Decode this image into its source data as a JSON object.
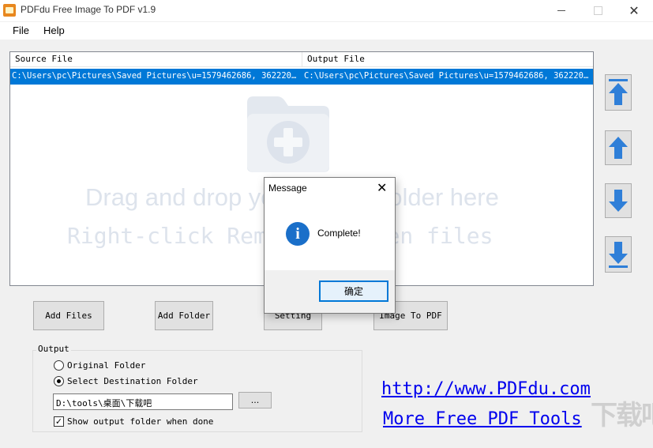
{
  "window": {
    "title": "PDFdu Free Image To PDF  v1.9",
    "app_icon": "pdfdu-logo-icon"
  },
  "menu": {
    "items": [
      "File",
      "Help"
    ]
  },
  "filelist": {
    "columns": [
      "Source File",
      "Output File"
    ],
    "rows": [
      {
        "source": "C:\\Users\\pc\\Pictures\\Saved Pictures\\u=1579462686, 36222013...",
        "output": "C:\\Users\\pc\\Pictures\\Saved Pictures\\u=1579462686, 36222013..."
      }
    ],
    "drag_hint": "Drag and drop your files or folder here",
    "rclick_hint": "Right-click Remove or open files"
  },
  "buttons": {
    "add_files": "Add Files",
    "add_folder": "Add Folder",
    "setting": "Setting",
    "image_to_pdf": "Image To PDF"
  },
  "output": {
    "title": "Output",
    "original_folder": "Original Folder",
    "select_destination": "Select Destination Folder",
    "selected_option": "Select Destination Folder",
    "path": "D:\\tools\\桌面\\下载吧",
    "browse": "...",
    "show_folder": "Show output folder when done",
    "show_folder_checked": true
  },
  "links": {
    "website": "http://www.PDFdu.com ",
    "more_tools": "More Free PDF Tools"
  },
  "dialog": {
    "title": "Message",
    "message": "Complete!",
    "ok": "确定",
    "icon": "info-icon"
  },
  "watermark": "下载吧"
}
